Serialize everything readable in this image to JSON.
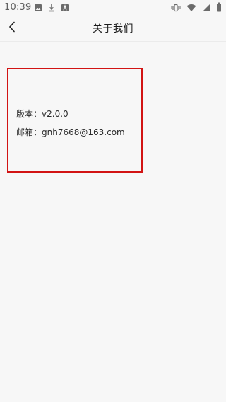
{
  "status_bar": {
    "time": "10:39",
    "left_icons": [
      "image-icon",
      "download-icon",
      "a-icon"
    ],
    "right_icons": [
      "vibrate-icon",
      "wifi-icon",
      "signal-icon",
      "battery-icon"
    ]
  },
  "app_bar": {
    "title": "关于我们",
    "back_icon": "chevron-left-icon"
  },
  "about": {
    "version_label": "版本：",
    "version_value": "v2.0.0",
    "email_label": "邮箱：",
    "email_value": "gnh7668@163.com"
  },
  "colors": {
    "background": "#f7f7f7",
    "highlight_border": "#d21414",
    "text_primary": "#1c1c1c"
  }
}
